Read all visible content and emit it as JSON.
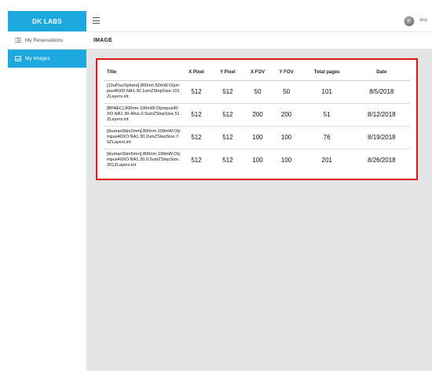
{
  "sidebar": {
    "brand": "DK LABS",
    "items": [
      {
        "label": "My Reservations",
        "icon": "list-icon",
        "active": false
      },
      {
        "label": "My Images",
        "icon": "image-icon",
        "active": true
      }
    ]
  },
  "header": {
    "menu_icon": "hamburger-icon",
    "username": "test"
  },
  "page": {
    "title": "IMAGE"
  },
  "table": {
    "columns": [
      "Title",
      "X Pixel",
      "Y Pixel",
      "X FOV",
      "Y FOV",
      "Total pages",
      "Date"
    ],
    "rows": [
      {
        "title": "[10uFluoSphere].800nm.50mW.Olympus40XO.NA1.30.1umZStepSize.101ZLayers.int",
        "x_pixel": "512",
        "y_pixel": "512",
        "x_fov": "50",
        "y_fov": "50",
        "total_pages": "101",
        "date": "8/5/2018"
      },
      {
        "title": "[BPAEC].800nm.100mW.Olympus40XO.NA1.30.40us.0.5umZStepSize.51ZLayers.int",
        "x_pixel": "512",
        "y_pixel": "512",
        "x_fov": "200",
        "y_fov": "200",
        "total_pages": "51",
        "date": "8/12/2018"
      },
      {
        "title": "[HumanSkin2mm].800nm.100mW.Olympus40XO.NA1.30.2umZStepSize.76ZLayers.int",
        "x_pixel": "512",
        "y_pixel": "512",
        "x_fov": "100",
        "y_fov": "100",
        "total_pages": "76",
        "date": "8/19/2018"
      },
      {
        "title": "[HumanSkin5mm].800nm.100mW.Olympus40XO.NA1.30.0.5umZStepSize.201ZLayers.int",
        "x_pixel": "512",
        "y_pixel": "512",
        "x_fov": "100",
        "y_fov": "100",
        "total_pages": "201",
        "date": "8/26/2018"
      }
    ]
  },
  "colors": {
    "accent": "#1da9e0",
    "highlight_border": "#e01717",
    "content_bg": "#e4e5e7"
  }
}
